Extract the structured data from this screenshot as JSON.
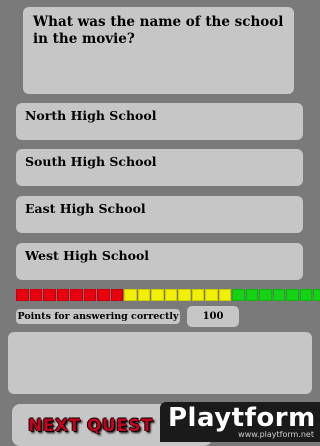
{
  "question": {
    "text": "What was the name of the school in the movie?"
  },
  "answers": [
    {
      "label": "North High School"
    },
    {
      "label": "South High School"
    },
    {
      "label": "East High School"
    },
    {
      "label": "West High School"
    }
  ],
  "timer_meter": {
    "segment_colors": [
      "#e8000f",
      "#e8000f",
      "#e8000f",
      "#e8000f",
      "#e8000f",
      "#e8000f",
      "#e8000f",
      "#e8000f",
      "#f0f000",
      "#f0f000",
      "#f0f000",
      "#f0f000",
      "#f0f000",
      "#f0f000",
      "#f0f000",
      "#f0f000",
      "#14d214",
      "#14d214",
      "#14d214",
      "#14d214",
      "#14d214",
      "#14d214",
      "#14d214"
    ],
    "colors": {
      "red": "#e8000f",
      "yellow": "#f0f000",
      "green": "#14d214"
    }
  },
  "points": {
    "label": "Points for answering correctly",
    "value": "100"
  },
  "next_button": {
    "label": "NEXT QUEST"
  },
  "watermark": {
    "logo_text": "Playtform",
    "url": "www.playtform.net"
  }
}
